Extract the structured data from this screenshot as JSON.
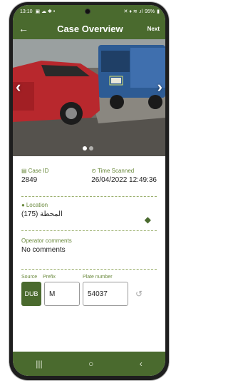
{
  "status_bar": {
    "time": "13:10",
    "battery": "95%"
  },
  "app_bar": {
    "title": "Case Overview",
    "next_label": "Next"
  },
  "carousel": {
    "total_images": 2,
    "active_index": 0
  },
  "case": {
    "id_label": "Case ID",
    "id_value": "2849",
    "time_label": "Time Scanned",
    "time_value": "26/04/2022 12:49:36",
    "location_label": "Location",
    "location_value": "المحطة (175)",
    "comments_label": "Operator comments",
    "comments_value": "No comments"
  },
  "plate": {
    "source_label": "Source",
    "prefix_label": "Prefix",
    "number_label": "Plate number",
    "source_value": "DUB",
    "prefix_value": "M",
    "number_value": "54037"
  },
  "colors": {
    "brand": "#4a6a2e",
    "accent_label": "#6b8a3e"
  },
  "icons": {
    "back": "arrow-left-icon",
    "navigate": "directions-icon",
    "history": "history-icon"
  }
}
